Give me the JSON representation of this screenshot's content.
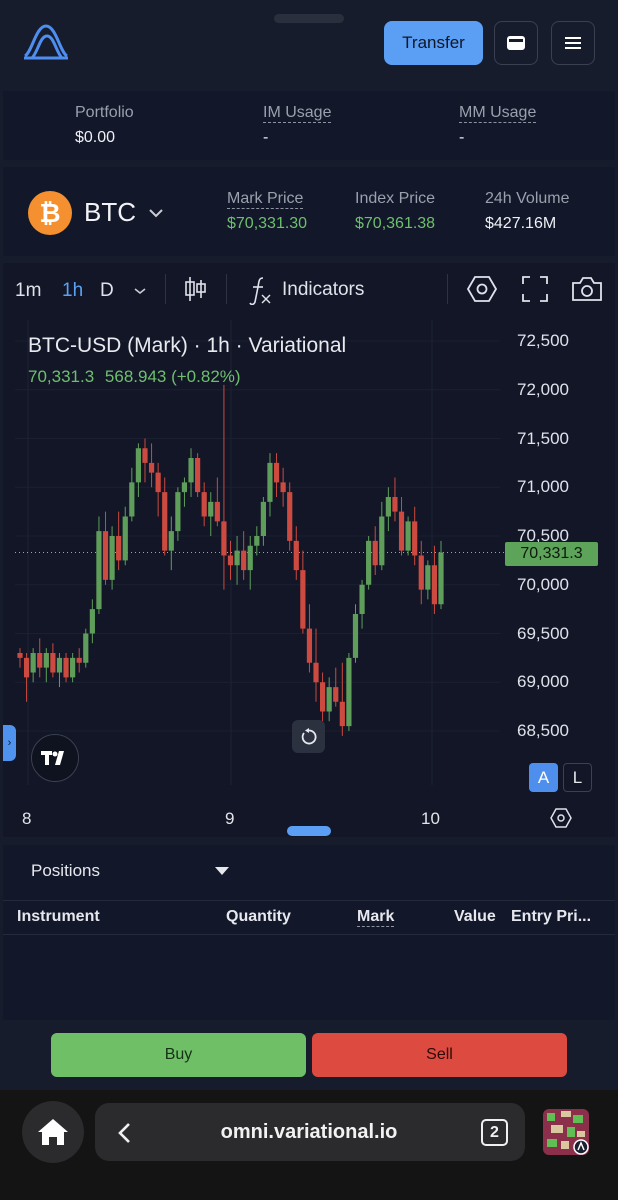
{
  "header": {
    "transfer_label": "Transfer"
  },
  "portfolio": {
    "items": [
      {
        "label": "Portfolio",
        "value": "$0.00"
      },
      {
        "label": "IM Usage",
        "value": "-"
      },
      {
        "label": "MM Usage",
        "value": "-"
      }
    ]
  },
  "ticker": {
    "symbol": "BTC",
    "mark_label": "Mark Price",
    "mark_value": "$70,331.30",
    "index_label": "Index Price",
    "index_value": "$70,361.38",
    "volume_label": "24h Volume",
    "volume_value": "$427.16M"
  },
  "toolbar": {
    "intervals": [
      "1m",
      "1h",
      "D"
    ],
    "indicators_label": "Indicators"
  },
  "chart": {
    "title": "BTC-USD (Mark) · 1h · Variational",
    "last": "70,331.3",
    "change": "568.943 (+0.82%)",
    "price_tag": "70,331.3",
    "y_ticks": [
      "72,500",
      "72,000",
      "71,500",
      "71,000",
      "70,500",
      "70,000",
      "69,500",
      "69,000",
      "68,500"
    ],
    "x_ticks": [
      "8",
      "9",
      "10"
    ],
    "auto_label": "A",
    "log_label": "L"
  },
  "chart_data": {
    "type": "candlestick",
    "title": "BTC-USD (Mark) · 1h · Variational",
    "ylim": [
      68200,
      72800
    ],
    "x_ticks": [
      "8",
      "9",
      "10"
    ],
    "ohlc": [
      [
        69300,
        69350,
        69150,
        69250
      ],
      [
        69250,
        69300,
        68800,
        69050
      ],
      [
        69100,
        69350,
        69000,
        69300
      ],
      [
        69300,
        69450,
        69050,
        69150
      ],
      [
        69150,
        69350,
        69000,
        69300
      ],
      [
        69300,
        69400,
        69050,
        69100
      ],
      [
        69100,
        69300,
        68950,
        69250
      ],
      [
        69250,
        69300,
        69000,
        69050
      ],
      [
        69050,
        69300,
        69000,
        69250
      ],
      [
        69250,
        69350,
        69100,
        69200
      ],
      [
        69200,
        69550,
        69150,
        69500
      ],
      [
        69500,
        69850,
        69400,
        69750
      ],
      [
        69750,
        70700,
        69700,
        70550
      ],
      [
        70550,
        70750,
        70000,
        70050
      ],
      [
        70050,
        70600,
        69950,
        70500
      ],
      [
        70500,
        70750,
        70150,
        70250
      ],
      [
        70250,
        70800,
        70200,
        70700
      ],
      [
        70700,
        71200,
        70650,
        71050
      ],
      [
        71050,
        71450,
        70900,
        71400
      ],
      [
        71400,
        71500,
        71050,
        71250
      ],
      [
        71250,
        71450,
        71000,
        71150
      ],
      [
        71150,
        71250,
        70700,
        70950
      ],
      [
        70950,
        71100,
        70300,
        70350
      ],
      [
        70350,
        70700,
        70150,
        70550
      ],
      [
        70550,
        71000,
        70450,
        70950
      ],
      [
        70950,
        71100,
        70800,
        71050
      ],
      [
        71050,
        71400,
        70900,
        71300
      ],
      [
        71300,
        71350,
        70900,
        70950
      ],
      [
        70950,
        71050,
        70600,
        70700
      ],
      [
        70700,
        70950,
        70500,
        70850
      ],
      [
        70850,
        71100,
        70600,
        70650
      ],
      [
        70650,
        72050,
        69950,
        70300
      ],
      [
        70300,
        70450,
        70050,
        70200
      ],
      [
        70200,
        70500,
        70000,
        70350
      ],
      [
        70350,
        70550,
        70050,
        70150
      ],
      [
        70150,
        70500,
        69950,
        70400
      ],
      [
        70400,
        70600,
        70300,
        70500
      ],
      [
        70500,
        70900,
        70400,
        70850
      ],
      [
        70850,
        71350,
        70700,
        71250
      ],
      [
        71250,
        71350,
        70900,
        71050
      ],
      [
        71050,
        71200,
        70800,
        70950
      ],
      [
        70950,
        71050,
        70350,
        70450
      ],
      [
        70450,
        70600,
        70050,
        70150
      ],
      [
        70150,
        70350,
        69500,
        69550
      ],
      [
        69550,
        69800,
        69100,
        69200
      ],
      [
        69200,
        69550,
        68800,
        69000
      ],
      [
        69000,
        69100,
        68600,
        68700
      ],
      [
        68700,
        69050,
        68600,
        68950
      ],
      [
        68950,
        69150,
        68750,
        68800
      ],
      [
        68800,
        69200,
        68450,
        68550
      ],
      [
        68550,
        69300,
        68500,
        69250
      ],
      [
        69250,
        69800,
        69200,
        69700
      ],
      [
        69700,
        70050,
        69550,
        70000
      ],
      [
        70000,
        70500,
        69950,
        70450
      ],
      [
        70450,
        70600,
        70100,
        70200
      ],
      [
        70200,
        70850,
        70150,
        70700
      ],
      [
        70700,
        71000,
        70550,
        70900
      ],
      [
        70900,
        71100,
        70650,
        70750
      ],
      [
        70750,
        70900,
        70300,
        70350
      ],
      [
        70350,
        70700,
        70300,
        70650
      ],
      [
        70650,
        70800,
        70200,
        70300
      ],
      [
        70300,
        70450,
        69800,
        69950
      ],
      [
        69950,
        70250,
        69850,
        70200
      ],
      [
        70200,
        70400,
        69700,
        69800
      ],
      [
        69800,
        70450,
        69750,
        70331
      ]
    ]
  }
}
